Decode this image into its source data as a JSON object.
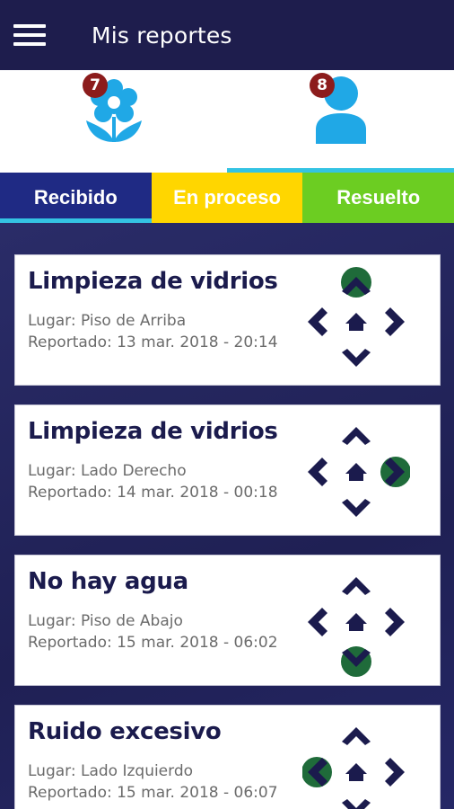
{
  "appbar": {
    "title": "Mis reportes",
    "menu_icon": "hamburger-menu-icon"
  },
  "categories": [
    {
      "icon": "flower-icon",
      "badge": "7",
      "active": false
    },
    {
      "icon": "user-icon",
      "badge": "8",
      "active": true
    }
  ],
  "tabs": [
    {
      "label": "Recibido",
      "color": "#1f2a84",
      "active": true
    },
    {
      "label": "En proceso",
      "color": "#ffd600",
      "active": false
    },
    {
      "label": "Resuelto",
      "color": "#6ccd22",
      "active": false
    }
  ],
  "colors": {
    "navy": "#1e1d4d",
    "accent": "#34c3e3",
    "badge": "#8c1c1c",
    "highlight_green": "#1f6b3a"
  },
  "reports": [
    {
      "title": "Limpieza de vidrios",
      "place": "Lugar: Piso de Arriba",
      "reported": "Reportado: 13 mar. 2018 - 20:14",
      "direction": "up"
    },
    {
      "title": "Limpieza de vidrios",
      "place": "Lugar: Lado Derecho",
      "reported": "Reportado: 14 mar. 2018 - 00:18",
      "direction": "right"
    },
    {
      "title": "No hay agua",
      "place": "Lugar: Piso de Abajo",
      "reported": "Reportado: 15 mar. 2018 - 06:02",
      "direction": "down"
    },
    {
      "title": "Ruido excesivo",
      "place": "Lugar: Lado Izquierdo",
      "reported": "Reportado: 15 mar. 2018 - 06:07",
      "direction": "left"
    }
  ]
}
